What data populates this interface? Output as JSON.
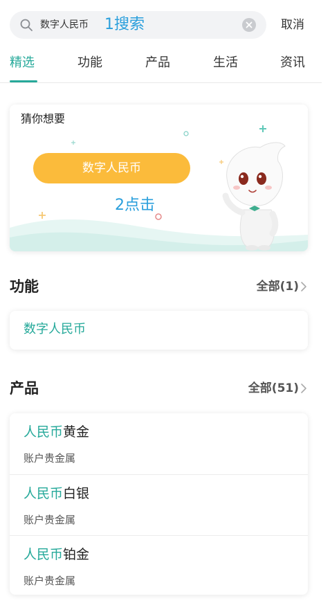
{
  "search": {
    "query": "数字人民币",
    "cancel_label": "取消",
    "annotation": "1搜索"
  },
  "tabs": [
    {
      "label": "精选",
      "active": true
    },
    {
      "label": "功能",
      "active": false
    },
    {
      "label": "产品",
      "active": false
    },
    {
      "label": "生活",
      "active": false
    },
    {
      "label": "资讯",
      "active": false
    }
  ],
  "guess": {
    "title": "猜你想要",
    "chip_label": "数字人民币",
    "annotation": "2点击"
  },
  "functions": {
    "title": "功能",
    "all_label": "全部(1)",
    "items": [
      {
        "label": "数字人民币"
      }
    ]
  },
  "products": {
    "title": "产品",
    "all_label": "全部(51)",
    "items": [
      {
        "highlight": "人民币",
        "rest": "黄金",
        "category": "账户贵金属"
      },
      {
        "highlight": "人民币",
        "rest": "白银",
        "category": "账户贵金属"
      },
      {
        "highlight": "人民币",
        "rest": "铂金",
        "category": "账户贵金属"
      }
    ]
  },
  "colors": {
    "accent": "#26a99a",
    "chip": "#fbbb3b",
    "annotation": "#2a9fdc"
  },
  "icons": [
    "search-icon",
    "clear-icon",
    "chevron-right-icon",
    "mascot-illustration"
  ]
}
